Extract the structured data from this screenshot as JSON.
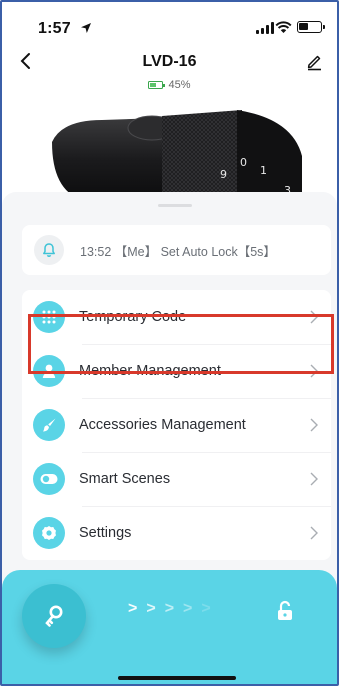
{
  "status_bar": {
    "time": "1:57"
  },
  "header": {
    "title": "LVD-16",
    "battery_level": "45%"
  },
  "log": {
    "entry": "13:52 【Me】 Set Auto Lock【5s】"
  },
  "menu": {
    "items": [
      {
        "label": "Temporary Code",
        "icon": "keypad-grid-icon"
      },
      {
        "label": "Member Management",
        "icon": "person-icon"
      },
      {
        "label": "Accessories Management",
        "icon": "brush-icon"
      },
      {
        "label": "Smart Scenes",
        "icon": "toggle-icon"
      },
      {
        "label": "Settings",
        "icon": "gear-icon"
      }
    ],
    "highlighted_item": "Settings"
  },
  "colors": {
    "accent": "#5ad4e6",
    "accent_dark": "#3bbfd1",
    "highlight_border": "#d8392b",
    "battery_green": "#5cc46a"
  }
}
